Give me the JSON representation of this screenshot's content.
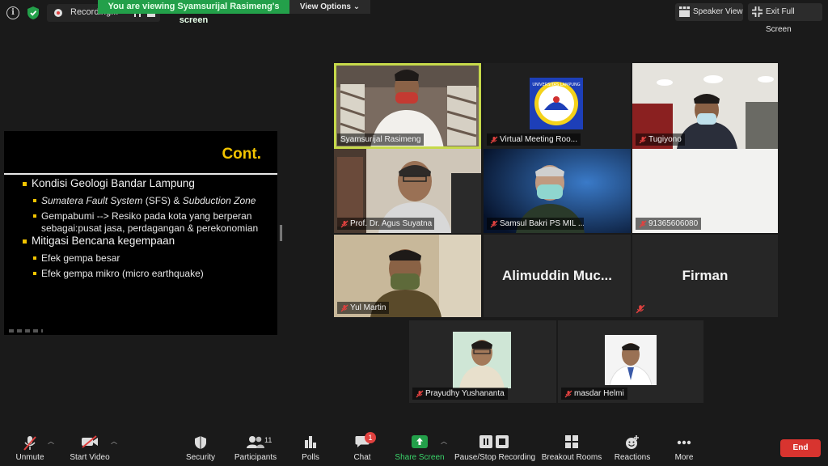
{
  "topbar": {
    "recording_label": "Recording...",
    "banner": "You are viewing Syamsurijal Rasimeng's screen",
    "view_options": "View Options",
    "speaker_view": "Speaker View",
    "exit_full_screen": "Exit Full Screen"
  },
  "slide": {
    "title": "Cont.",
    "b1": "Kondisi Geologi Bandar Lampung",
    "b1a_italic1": "Sumatera Fault System",
    "b1a_mid": " (SFS) & ",
    "b1a_italic2": "Subduction Zone",
    "b1b_line1": "Gempabumi --> Resiko pada kota yang berperan",
    "b1b_line2": "sebagai:pusat jasa, perdagangan & perekonomian",
    "b2": "Mitigasi Bencana kegempaan",
    "b2a": "Efek gempa besar",
    "b2b": "Efek gempa mikro (micro earthquake)"
  },
  "participants": [
    {
      "name": "Syamsurijal Rasimeng",
      "muted": false,
      "active": true
    },
    {
      "name": "Virtual Meeting Roo...",
      "muted": true
    },
    {
      "name": "Tugiyono",
      "muted": true
    },
    {
      "name": "Prof. Dr. Agus Suyatna",
      "muted": true
    },
    {
      "name": "Samsul Bakri PS MIL ...",
      "muted": true
    },
    {
      "name": "91365606080",
      "muted": true
    },
    {
      "name": "Yul Martin",
      "muted": true
    },
    {
      "name": "Alimuddin  Muc...",
      "muted": true
    },
    {
      "name": "Firman",
      "muted": true
    },
    {
      "name": "Prayudhy Yushananta",
      "muted": true
    },
    {
      "name": "masdar Helmi",
      "muted": true
    }
  ],
  "logo_text": "UNIVERSITAS LAMPUNG",
  "toolbar": {
    "unmute": "Unmute",
    "start_video": "Start Video",
    "security": "Security",
    "participants": "Participants",
    "participants_count": "11",
    "polls": "Polls",
    "chat": "Chat",
    "chat_badge": "1",
    "share_screen": "Share Screen",
    "pause_stop_recording": "Pause/Stop Recording",
    "breakout_rooms": "Breakout Rooms",
    "reactions": "Reactions",
    "more": "More",
    "end": "End"
  },
  "colors": {
    "accent_green": "#23a04a",
    "active_border": "#c6d94a",
    "slide_title": "#f2c400",
    "end_red": "#d8342f",
    "badge_red": "#e0413f"
  }
}
